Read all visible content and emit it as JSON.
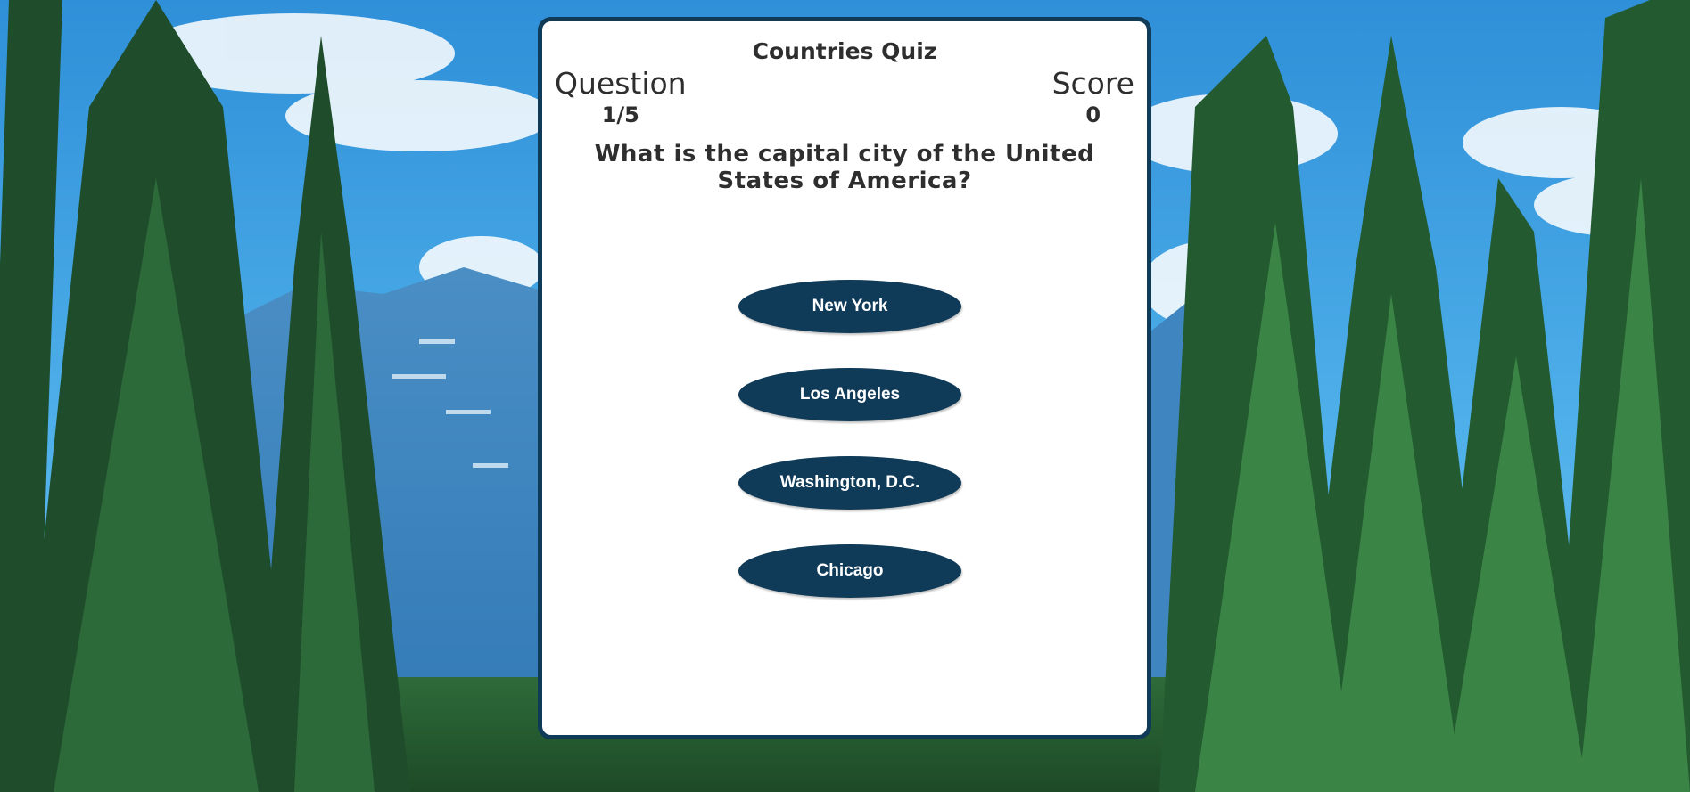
{
  "quiz": {
    "title": "Countries Quiz",
    "question_label": "Question",
    "question_progress": "1/5",
    "score_label": "Score",
    "score_value": "0",
    "question_text": "What is the capital city of the United States of America?",
    "answers": [
      {
        "label": "New York"
      },
      {
        "label": "Los Angeles"
      },
      {
        "label": "Washington, D.C."
      },
      {
        "label": "Chicago"
      }
    ]
  },
  "colors": {
    "accent": "#0f3a58",
    "card_background": "#ffffff",
    "text": "#2e2e2e",
    "sky": "#3a9de0",
    "forest": "#1f4a2a"
  }
}
